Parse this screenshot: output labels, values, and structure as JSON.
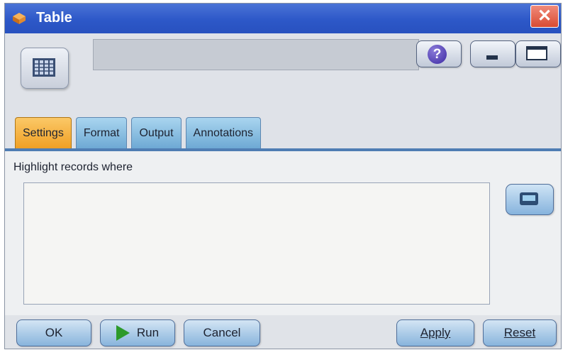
{
  "window": {
    "title": "Table",
    "close_glyph": "✕",
    "icon": "node-table-icon"
  },
  "header": {
    "node_name": "",
    "help_glyph": "?"
  },
  "tabs": [
    {
      "label": "Settings",
      "active": true
    },
    {
      "label": "Format",
      "active": false
    },
    {
      "label": "Output",
      "active": false
    },
    {
      "label": "Annotations",
      "active": false
    }
  ],
  "settings": {
    "highlight_label": "Highlight records where",
    "expression": ""
  },
  "footer": {
    "ok": "OK",
    "run": "Run",
    "cancel": "Cancel",
    "apply": "Apply",
    "reset": "Reset"
  },
  "colors": {
    "titlebar": "#2d58c8",
    "active_tab": "#f0a025",
    "inactive_tab": "#6ea9d4",
    "button": "#88b4dc",
    "run_icon": "#2d9a2a"
  }
}
